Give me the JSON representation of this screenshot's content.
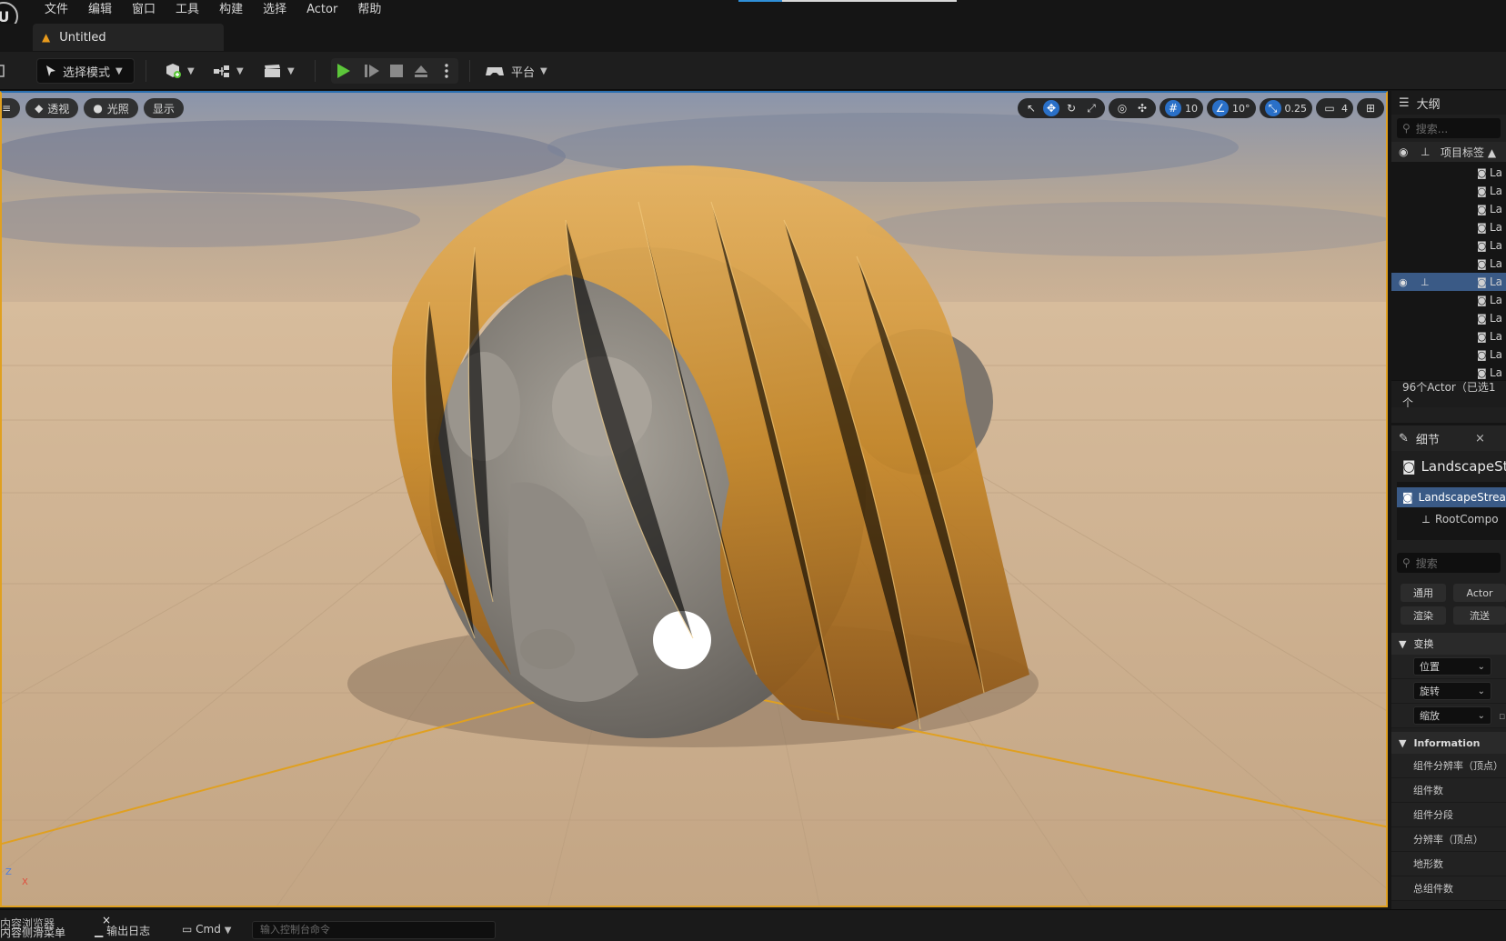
{
  "menu": {
    "logo": "U",
    "items": [
      "文件",
      "编辑",
      "窗口",
      "工具",
      "构建",
      "选择",
      "Actor",
      "帮助"
    ]
  },
  "tab": {
    "title": "Untitled"
  },
  "toolbar": {
    "mode_label": "选择模式",
    "platform_label": "平台"
  },
  "viewport": {
    "perspective_label": "透视",
    "lighting_label": "光照",
    "show_label": "显示",
    "grid_snap": "10",
    "rotate_snap": "10°",
    "scale_snap": "0.25",
    "camera_speed": "4",
    "axis_z": "Z",
    "axis_x": "X"
  },
  "outliner": {
    "title": "大纲",
    "search_placeholder": "搜索...",
    "column_label": "项目标签",
    "row_prefix": "La",
    "row_count": 12,
    "selected_row": 6,
    "footer": "96个Actor（已选1个"
  },
  "details": {
    "tab_label": "细节",
    "close": "×",
    "actor_name": "LandscapeSt",
    "component_root": "LandscapeStrea",
    "component_child": "RootCompo",
    "search_placeholder": "搜索",
    "categories": [
      "通用",
      "Actor",
      "渲染",
      "流送"
    ],
    "transform_section": "变换",
    "location_label": "位置",
    "rotation_label": "旋转",
    "scale_label": "缩放",
    "info_section": "Information",
    "info_rows": [
      "组件分辨率（顶点）",
      "组件数",
      "组件分段",
      "分辨率（顶点）",
      "地形数",
      "总组件数"
    ]
  },
  "bottombar": {
    "content_drawer": "内容侧滑菜单",
    "content_browser": "内容浏览器",
    "close": "×",
    "output_log": "输出日志",
    "cmd_label": "Cmd",
    "cmd_placeholder": "输入控制台命令"
  },
  "colors": {
    "accent_blue": "#2a70c8",
    "selection_orange": "#e0a020",
    "play_green": "#5cc63a",
    "warning_orange": "#e89a1c"
  }
}
